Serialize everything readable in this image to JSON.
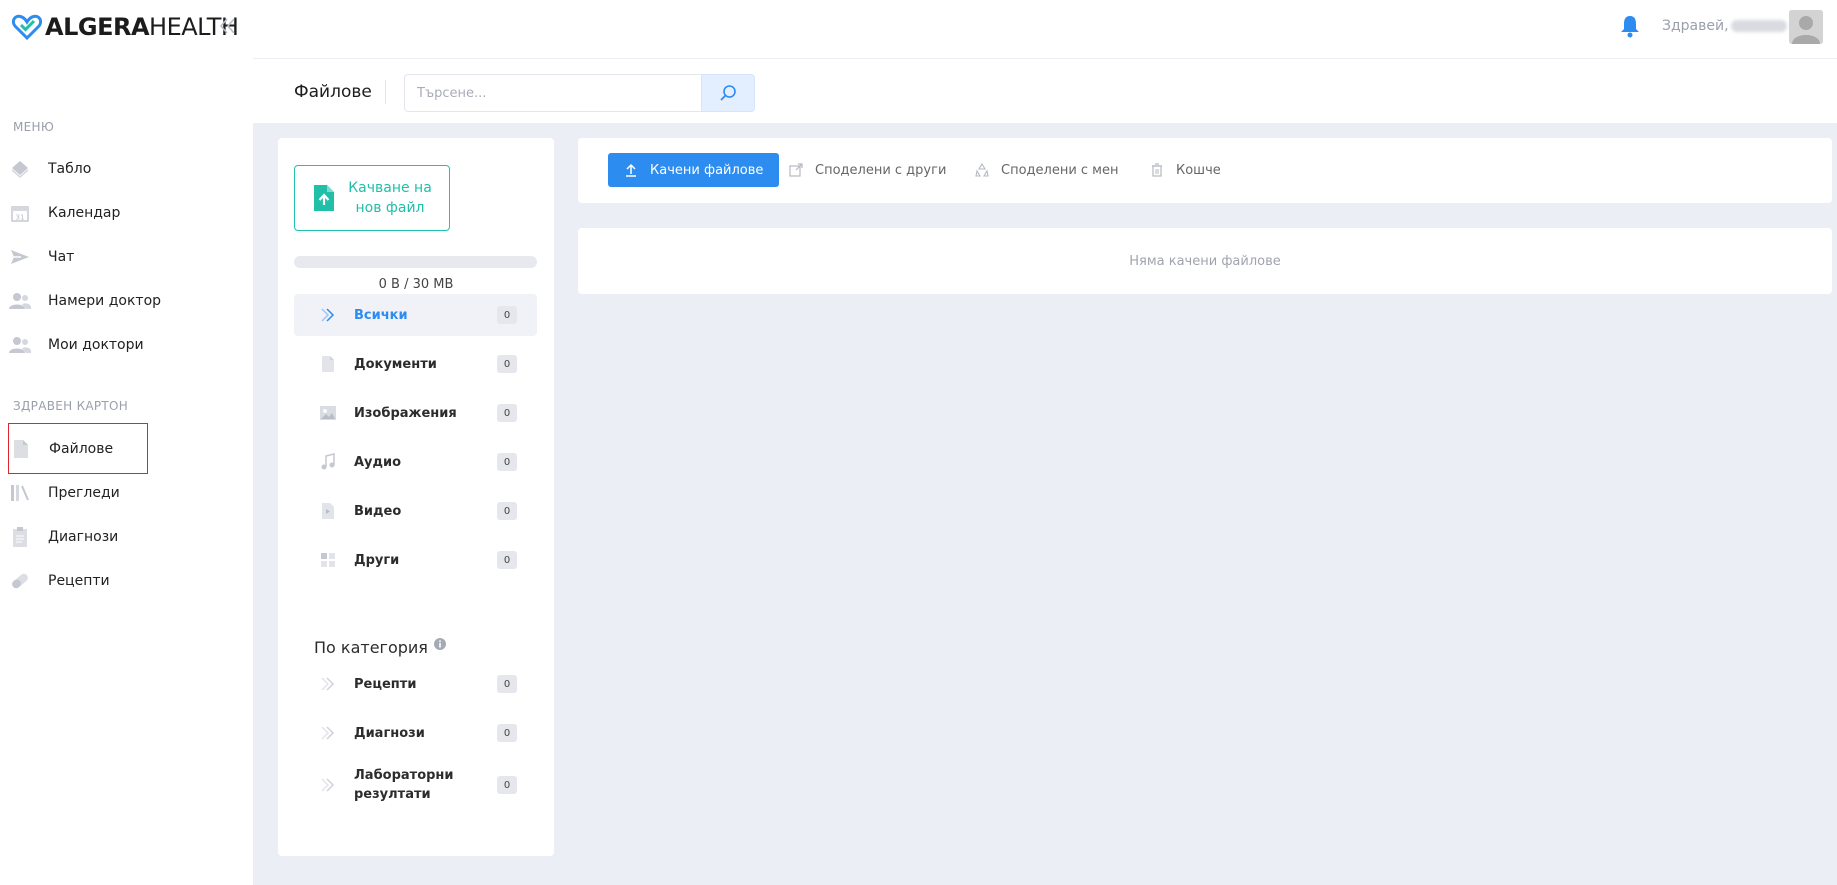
{
  "brand": {
    "part1": "ALGERA",
    "part2": "HEALTH"
  },
  "sidebar": {
    "menu_title": "МЕНЮ",
    "menu_items": [
      {
        "label": "Табло",
        "icon": "diamond-icon"
      },
      {
        "label": "Календар",
        "icon": "calendar-icon"
      },
      {
        "label": "Чат",
        "icon": "send-icon"
      },
      {
        "label": "Намери доктор",
        "icon": "users-icon"
      },
      {
        "label": "Мои доктори",
        "icon": "users-icon"
      }
    ],
    "record_title": "ЗДРАВЕН КАРТОН",
    "record_items": [
      {
        "label": "Файлове",
        "icon": "file-icon",
        "active": true
      },
      {
        "label": "Прегледи",
        "icon": "books-icon"
      },
      {
        "label": "Диагнози",
        "icon": "clipboard-icon"
      },
      {
        "label": "Рецепти",
        "icon": "pill-icon"
      }
    ]
  },
  "topbar": {
    "greeting": "Здравей,"
  },
  "header": {
    "title": "Файлове",
    "search_placeholder": "Търсене..."
  },
  "files": {
    "upload_label": "Качване на нов файл",
    "storage": "0 B / 30 MB",
    "storage_used_fraction": 0,
    "categories": [
      {
        "label": "Всички",
        "count": "0",
        "icon": "chevron-right-icon",
        "active": true
      },
      {
        "label": "Документи",
        "count": "0",
        "icon": "document-icon"
      },
      {
        "label": "Изображения",
        "count": "0",
        "icon": "image-icon"
      },
      {
        "label": "Аудио",
        "count": "0",
        "icon": "music-icon"
      },
      {
        "label": "Видео",
        "count": "0",
        "icon": "video-icon"
      },
      {
        "label": "Други",
        "count": "0",
        "icon": "grid-icon"
      }
    ],
    "by_category_title": "По категория",
    "by_category": [
      {
        "label": "Рецепти",
        "count": "0"
      },
      {
        "label": "Диагнози",
        "count": "0"
      },
      {
        "label": "Лабораторни резултати",
        "count": "0"
      }
    ]
  },
  "tabs": [
    {
      "label": "Качени файлове",
      "icon": "upload-icon",
      "active": true
    },
    {
      "label": "Споделени с други",
      "icon": "share-icon"
    },
    {
      "label": "Споделени с мен",
      "icon": "recycle-icon"
    },
    {
      "label": "Кошче",
      "icon": "trash-icon"
    }
  ],
  "empty_message": "Няма качени файлове",
  "colors": {
    "accent": "#2d8cf0",
    "upload": "#1fbfa8",
    "highlight": "#e0242f",
    "background": "#eceef5"
  }
}
